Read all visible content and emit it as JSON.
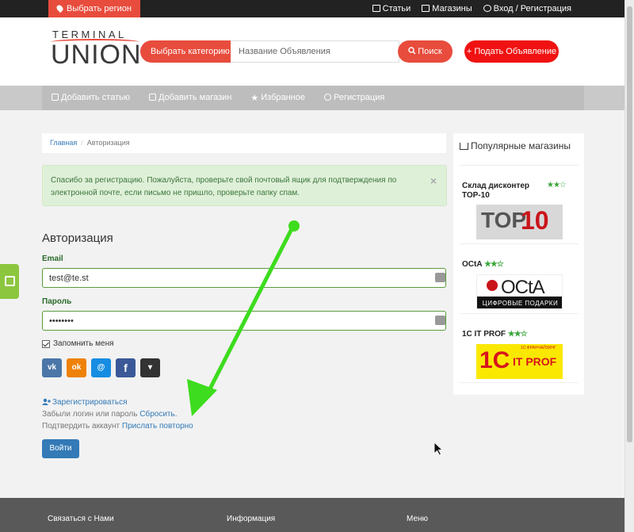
{
  "topbar": {
    "region_label": "Выбрать регион",
    "links": [
      "Статьи",
      "Магазины",
      "Вход / Регистрация"
    ]
  },
  "header": {
    "logo_top": "TERMINAL",
    "logo_bottom": "UNION",
    "category_label": "Выбрать категорию",
    "search_placeholder": "Название Объявления",
    "search_label": "Поиск",
    "add_ad_label": "+ Подать Объявление"
  },
  "nav": {
    "items": [
      "Добавить статью",
      "Добавить магазин",
      "Избранное",
      "Регистрация"
    ]
  },
  "breadcrumb": {
    "home": "Главная",
    "separator": "/",
    "current": "Авторизация"
  },
  "alert": {
    "text": "Спасибо за регистрацию. Пожалуйста, проверьте свой почтовый ящик для подтверждения по электронной почте, если письмо не пришло, проверьте папку спам.",
    "close": "×"
  },
  "auth": {
    "title": "Авторизация",
    "email_label": "Email",
    "email_value": "test@te.st",
    "password_label": "Пароль",
    "password_value": "••••••••",
    "remember_label": "Запомнить меня",
    "socials": [
      "vk",
      "ok",
      "@",
      "f",
      "▾"
    ],
    "register_label": "Зарегистрироваться",
    "forgot_text": "Забыли логин или пароль",
    "forgot_link": "Сбросить.",
    "confirm_text": "Подтвердить аккаунт",
    "confirm_link": "Прислать повторно",
    "login_button": "Войти"
  },
  "sidebar": {
    "title": "Популярные магазины",
    "shops": [
      {
        "name": "Склад дисконтер ТОР-10",
        "rating_text": "★★☆",
        "logo_a": "TOP",
        "logo_b": "10"
      },
      {
        "name": "OCtA",
        "rating_text": "★★☆",
        "logo_a": "OCtA",
        "logo_b": "ЦИФРОВЫЕ ПОДАРКИ"
      },
      {
        "name": "1С IT PROF",
        "rating_text": "★★☆",
        "logo_a": "1C",
        "logo_b": "IT PROF",
        "logo_c": "1С:ФРАНЧАЙЗИНГ"
      }
    ]
  },
  "footer": {
    "columns": [
      "Связаться с Нами",
      "Информация",
      "Меню"
    ]
  },
  "colors": {
    "accent": "#e84c3d",
    "link": "#337ab7",
    "success_bg": "#dff0d8",
    "annotation_arrow": "#3ddc1e"
  },
  "icons": {
    "region": "map-pin-icon",
    "articles": "edit-icon",
    "shops": "basket-icon",
    "login": "user-icon",
    "search": "search-icon",
    "favorites": "star-icon"
  }
}
